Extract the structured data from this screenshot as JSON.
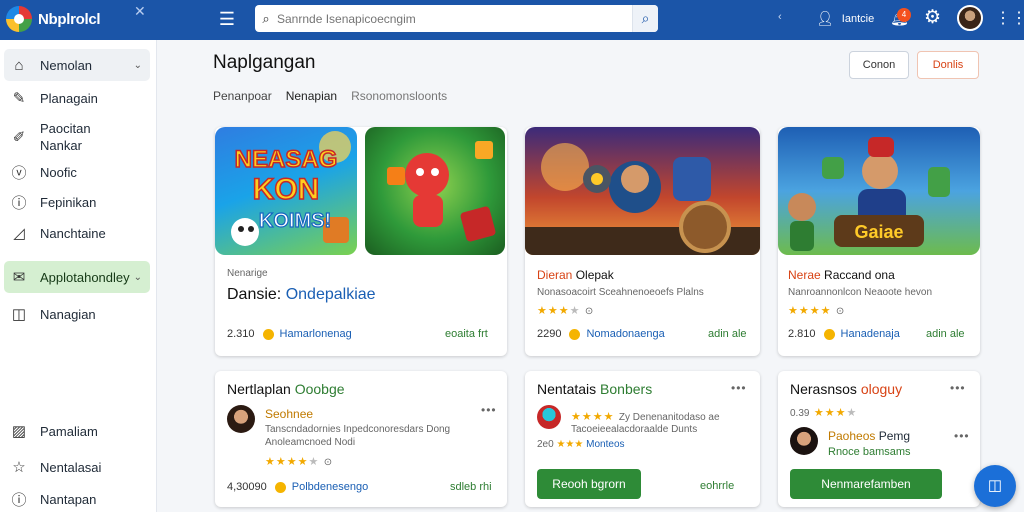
{
  "app": {
    "name": "Nbplrolcl"
  },
  "search": {
    "placeholder": "Sanrnde Isenapicoecngim"
  },
  "header": {
    "user_label": "Iantcie",
    "notification_count": "4"
  },
  "icons": {
    "search": "search-icon",
    "menu": "menu-icon",
    "user": "user-icon",
    "bell": "bell-icon",
    "gear": "gear-icon",
    "grid": "grid-icon",
    "fab": "app-switch-icon"
  },
  "colors": {
    "brand": "#1b55a8",
    "accent_green": "#2e8b37",
    "active_nav": "#d5efd1",
    "star": "#f2a900"
  },
  "sidebar": {
    "items": [
      {
        "label": "Nemolan"
      },
      {
        "label": "Planagain"
      },
      {
        "label": "Paocitan Nankar"
      },
      {
        "label": "Noofic"
      },
      {
        "label": "Fepinikan"
      },
      {
        "label": "Nanchtaine"
      },
      {
        "label": "Applotahondley"
      },
      {
        "label": "Nanagian"
      },
      {
        "label": "Pamaliam"
      },
      {
        "label": "Nentalasai"
      },
      {
        "label": "Nantapan"
      }
    ]
  },
  "page": {
    "title": "Naplgangan",
    "buttons": {
      "cancel": "Conon",
      "details": "Donlis"
    },
    "tabs": [
      "Penanpoar",
      "Nenapian",
      "Rsonomonsloonts"
    ]
  },
  "featured": {
    "banner1_title": [
      "NEASAG",
      "KON",
      "KOIMS!"
    ],
    "cards": [
      {
        "kicker": "Nenarige",
        "title_prefix": "Dansie:",
        "title": "Ondepalkiae",
        "rating": "2.310",
        "link": "Hamarlonenag",
        "price": "eoaita frt"
      },
      {
        "title_prefix": "Dieran",
        "title": "Olepak",
        "subtitle": "Nonasoacoirt Sceahnenoeoefs Plalns",
        "rating": "2290",
        "link": "Nomadonaenga",
        "price": "adin ale",
        "stars": 3
      },
      {
        "title_prefix": "Nerae",
        "title": "Raccand ona",
        "subtitle": "Nanroannonlcon Neaoote hevon",
        "banner_word": "Gaiae",
        "rating": "2.810",
        "link": "Hanadenaja",
        "price": "adin ale",
        "stars": 4
      }
    ]
  },
  "reviews": [
    {
      "title": "Nertlaplan",
      "title_accent": "Ooobge",
      "name": "Seohnee",
      "text": "Tanscndadornies Inpedconoresdars Dong",
      "text2": "Anoleamcnoed Nodi",
      "stars": 4,
      "rating": "4,30090",
      "link": "Polbdenesengo",
      "price": "sdleb rhi"
    },
    {
      "title": "Nentatais",
      "title_accent": "Bonbers",
      "meta": "Zy Denenanitodaso ae",
      "text": "Tacoeieealacdoraalde Dunts",
      "text2": "Monteos",
      "rating_small": "2e0",
      "stars": 4,
      "button": "Reooh bgrorn",
      "price": "eohrrle"
    },
    {
      "title": "Nerasnsos",
      "title_accent": "ologuy",
      "rating": "0.39",
      "name": "Paoheos",
      "name_suffix": "Pemg",
      "text": "Rnoce bamsams",
      "stars": 3,
      "button": "Nenmarefamben"
    }
  ]
}
